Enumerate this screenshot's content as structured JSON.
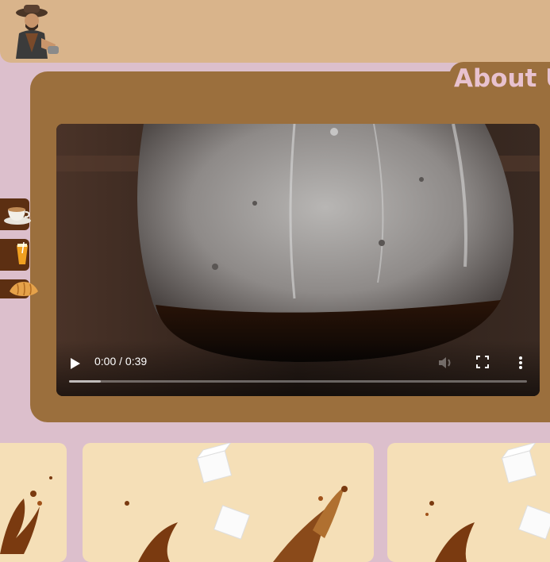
{
  "header": {
    "logo_icon": "barista-logo-icon"
  },
  "about": {
    "title": "About U"
  },
  "video": {
    "time_display": "0:00 / 0:39",
    "progress": 0.07,
    "controls": [
      "play-icon",
      "volume-icon",
      "fullscreen-icon",
      "more-options-icon"
    ]
  },
  "side_nav": {
    "items": [
      {
        "icon": "coffee-cup-icon"
      },
      {
        "icon": "iced-drink-icon"
      },
      {
        "icon": "croissant-icon"
      }
    ]
  },
  "products": {
    "cards": [
      {
        "icon": "coffee-splash-icon"
      },
      {
        "icon": "coffee-splash-sugar-icon"
      },
      {
        "icon": "coffee-splash-sugar-icon"
      }
    ]
  },
  "colors": {
    "page_bg": "#dcbfcc",
    "header_bg": "#d9b48b",
    "about_card": "#9b6f3d",
    "about_title": "#e8c2cf",
    "side_nav": "#5c2f12",
    "product_card": "#f5dfb7"
  }
}
